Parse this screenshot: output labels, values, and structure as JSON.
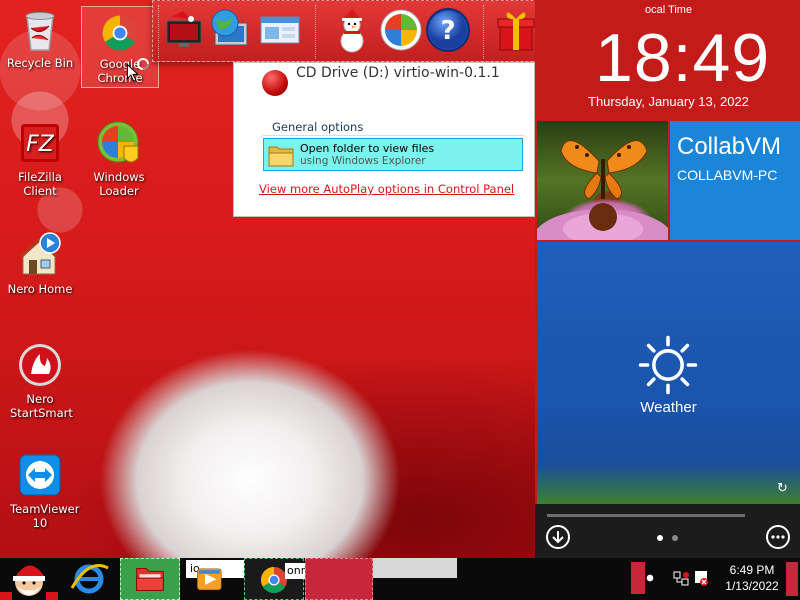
{
  "desktop_icons": [
    {
      "label": "Recycle Bin",
      "icon": "recycle-bin-icon"
    },
    {
      "label": "Google Chrome",
      "icon": "chrome-icon"
    },
    {
      "label": "FileZilla Client",
      "icon": "filezilla-icon"
    },
    {
      "label": "Windows Loader",
      "icon": "windows-loader-icon"
    },
    {
      "label": "Nero Home",
      "icon": "nero-home-icon"
    },
    {
      "label": "Nero StartSmart",
      "icon": "nero-startsmart-icon"
    },
    {
      "label": "TeamViewer 10",
      "icon": "teamviewer-icon"
    }
  ],
  "toolbar": {
    "icons": [
      "christmas-monitor-icon",
      "globe-monitor-icon",
      "control-panel-icon",
      "snowman-icon",
      "windows-orb-icon",
      "help-icon",
      "gift-icon",
      "folder-icon",
      "recycle-bin-icon"
    ]
  },
  "autoplay": {
    "drive_title": "CD Drive (D:) virtio-win-0.1.1",
    "section_label": "General options",
    "option_title": "Open folder to view files",
    "option_subtitle": "using Windows Explorer",
    "link_text": "View more AutoPlay options in Control Panel"
  },
  "clock": {
    "label": "ocal Time",
    "time": "18:49",
    "date": "Thursday, January 13, 2022"
  },
  "user_tile": {
    "name": "CollabVM",
    "computer": "COLLABVM-PC"
  },
  "weather_tile": {
    "label": "Weather"
  },
  "taskbar": {
    "tray_time": "6:49 PM",
    "tray_date": "1/13/2022",
    "partial_text_1": "io",
    "partial_text_2": "onn"
  },
  "colors": {
    "accent_red": "#c8141a",
    "tile_blue": "#1b86d8",
    "weather_blue": "#1f5fba",
    "option_highlight": "#7cf2ec",
    "link_red": "#d0181e"
  }
}
